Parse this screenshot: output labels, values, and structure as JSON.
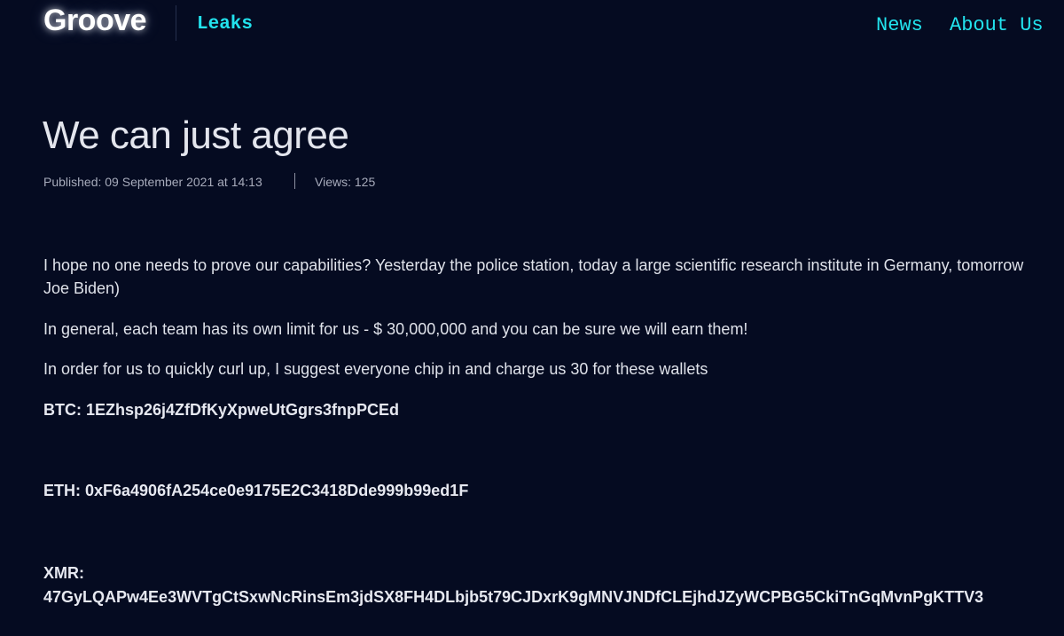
{
  "nav": {
    "brand": "Groove",
    "leaks": "Leaks",
    "news": "News",
    "about": "About Us"
  },
  "post": {
    "title": "We can just agree",
    "published": "Published: 09 September 2021 at 14:13",
    "views": "Views: 125",
    "paragraphs": [
      "I hope no one needs to prove our capabilities? Yesterday the police station, today a large scientific research institute in Germany, tomorrow Joe Biden)",
      "In general, each team has its own limit for us - $ 30,000,000 and you can be sure we will earn them!",
      "In order for us to quickly curl up, I suggest everyone chip in and charge us 30 for these wallets"
    ],
    "wallets": {
      "btc": "BTC: 1EZhsp26j4ZfDfKyXpweUtGgrs3fnpPCEd",
      "eth": "ETH: 0xF6a4906fA254ce0e9175E2C3418Dde999b99ed1F",
      "xmr_label": "XMR:",
      "xmr_value": "47GyLQAPw4Ee3WVTgCtSxwNcRinsEm3jdSX8FH4DLbjb5t79CJDxrK9gMNVJNDfCLEjhdJZyWCPBG5CkiTnGqMvnPgKTTV3"
    }
  },
  "colors": {
    "background": "#050b21",
    "accent": "#22e3ee",
    "text": "#e6e8f0",
    "muted": "#a7abbb"
  }
}
